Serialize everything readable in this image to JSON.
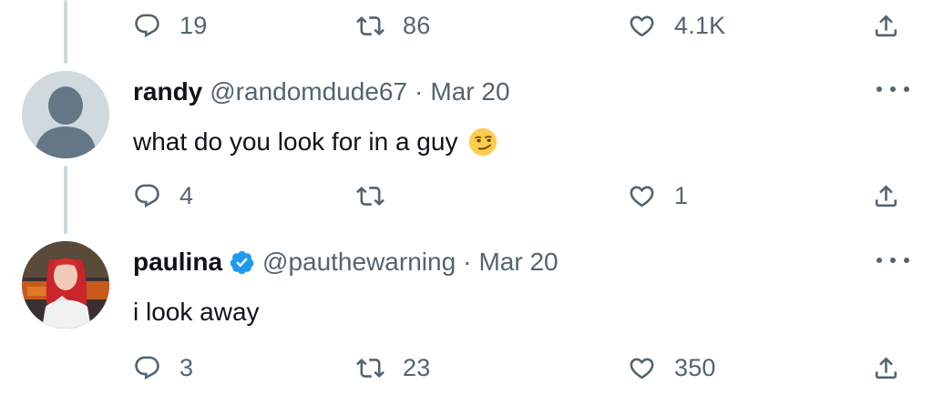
{
  "tweets": [
    {
      "id": "top",
      "replies": "19",
      "retweets": "86",
      "likes": "4.1K"
    },
    {
      "id": "randy",
      "display_name": "randy",
      "handle": "@randomdude67",
      "separator": "·",
      "date": "Mar 20",
      "text": "what do you look for in a guy",
      "emoji": "smirking-face-emoji",
      "avatar": "default-avatar",
      "replies": "4",
      "retweets": "",
      "likes": "1"
    },
    {
      "id": "paulina",
      "display_name": "paulina",
      "verified": true,
      "handle": "@pauthewarning",
      "separator": "·",
      "date": "Mar 20",
      "text": "i look away",
      "avatar": "profile-photo",
      "replies": "3",
      "retweets": "23",
      "likes": "350"
    }
  ],
  "colors": {
    "text_primary": "#0f1419",
    "text_secondary": "#536471",
    "thread_line": "#cfd9de",
    "verified_blue": "#1d9bf0"
  },
  "icons": [
    "reply-icon",
    "retweet-icon",
    "like-icon",
    "share-icon",
    "more-icon",
    "verified-icon"
  ]
}
